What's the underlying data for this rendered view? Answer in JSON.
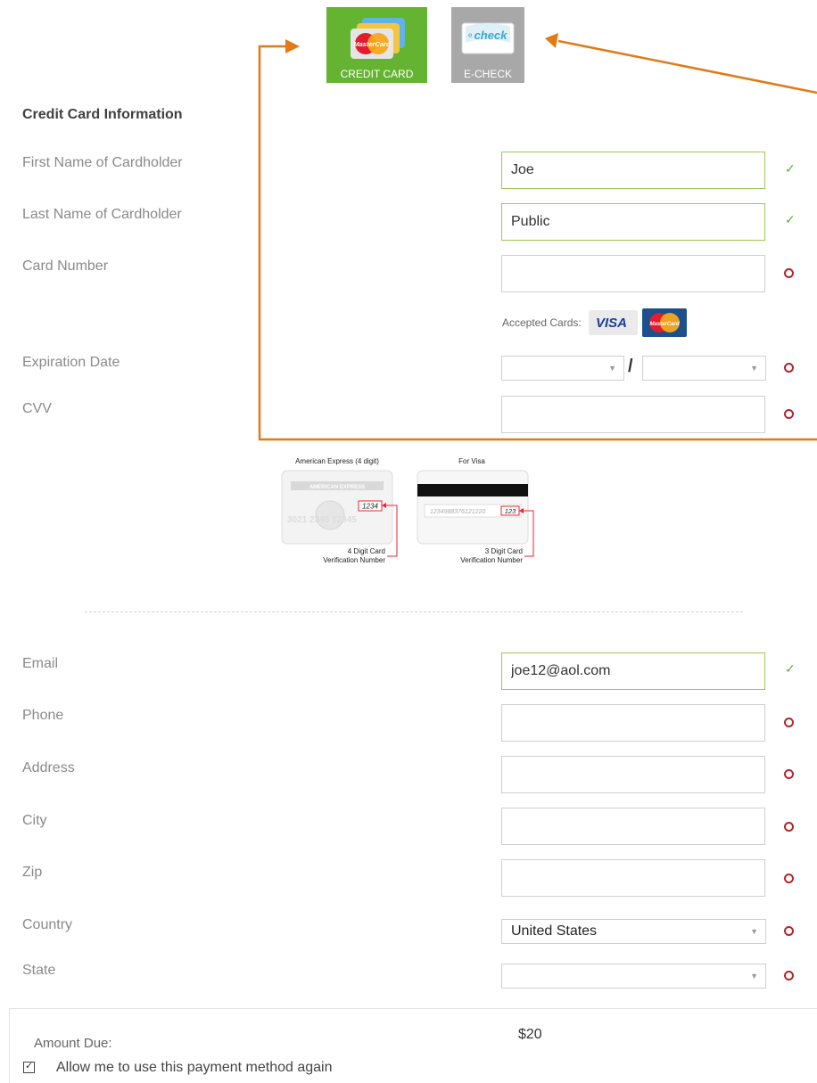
{
  "payment_tabs": {
    "credit_card": {
      "label": "CREDIT CARD",
      "logo_text": "MasterCard",
      "color": "#64b331"
    },
    "e_check": {
      "label": "E-CHECK",
      "logo_text": "check",
      "color": "#a8a8a8"
    }
  },
  "section_title": "Credit Card Information",
  "fields": {
    "first_name": {
      "label": "First Name of Cardholder",
      "value": "Joe",
      "status": "valid"
    },
    "last_name": {
      "label": "Last Name of Cardholder",
      "value": "Public",
      "status": "valid"
    },
    "card_number": {
      "label": "Card Number",
      "value": "",
      "status": "required"
    },
    "expiration": {
      "label": "Expiration Date",
      "month": "",
      "year": "",
      "separator": "/",
      "status": "required"
    },
    "cvv": {
      "label": "CVV",
      "value": "",
      "status": "required"
    },
    "email": {
      "label": "Email",
      "value": "joe12@aol.com",
      "status": "valid"
    },
    "phone": {
      "label": "Phone",
      "value": "",
      "status": "required"
    },
    "address": {
      "label": "Address",
      "value": "",
      "status": "required"
    },
    "city": {
      "label": "City",
      "value": "",
      "status": "required"
    },
    "zip": {
      "label": "Zip",
      "value": "",
      "status": "required"
    },
    "country": {
      "label": "Country",
      "value": "United States",
      "status": "required"
    },
    "state": {
      "label": "State",
      "value": "",
      "status": "required"
    }
  },
  "accepted_cards": {
    "label": "Accepted Cards:",
    "visa": "VISA",
    "mastercard": "MasterCard"
  },
  "cvv_help": {
    "amex": {
      "title": "American Express (4 digit)",
      "brand": "AMERICAN EXPRESS",
      "digits": "1234",
      "card_number": "3021 2345 12345",
      "caption_line1": "4 Digit Card",
      "caption_line2": "Verification Number"
    },
    "visa": {
      "title": "For Visa",
      "stripe_number": "1234988376121220",
      "digits": "123",
      "caption_line1": "3 Digit Card",
      "caption_line2": "Verification Number"
    }
  },
  "amount_due": {
    "label": "Amount Due:",
    "value": "$20"
  },
  "save_method": {
    "label": "Allow me to use this payment method again",
    "checked": true
  },
  "icons": {
    "valid": "checkmark-icon",
    "required": "ring-icon",
    "dropdown": "chevron-down-icon"
  },
  "colors": {
    "accent_green": "#64b331",
    "required_red": "#b3262d",
    "annotation_orange": "#e07b16",
    "valid_border": "#9cc95a"
  }
}
